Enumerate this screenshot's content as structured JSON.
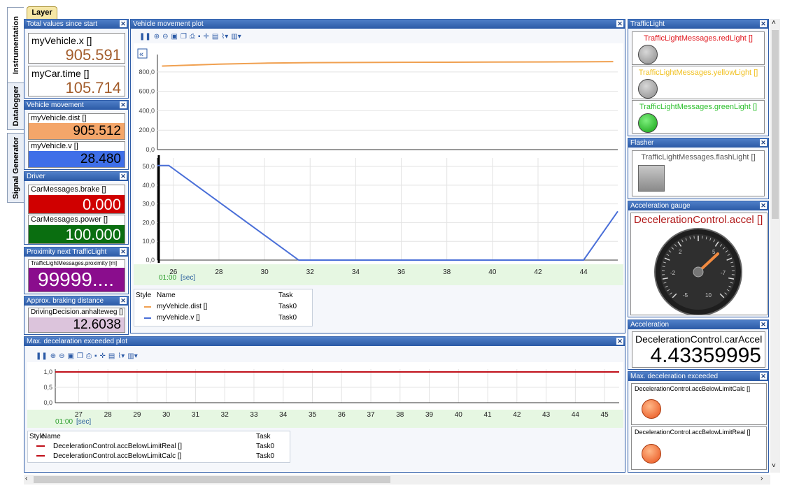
{
  "tabs": {
    "layer": "Layer",
    "vertical": [
      "Instrumentation",
      "Datalogger",
      "Signal Generator"
    ]
  },
  "panels": {
    "total": {
      "title": "Total values since start",
      "items": [
        {
          "label": "myVehicle.x []",
          "value": "905.591"
        },
        {
          "label": "myCar.time []",
          "value": "105.714"
        }
      ]
    },
    "movement": {
      "title": "Vehicle movement",
      "items": [
        {
          "label": "myVehicle.dist []",
          "value": "905.512"
        },
        {
          "label": "myVehicle.v []",
          "value": "28.480"
        }
      ]
    },
    "driver": {
      "title": "Driver",
      "items": [
        {
          "label": "CarMessages.brake []",
          "value": "0.000"
        },
        {
          "label": "CarMessages.power []",
          "value": "100.000"
        }
      ]
    },
    "proximity": {
      "title": "Proximity next TrafficLight",
      "label": "TrafficLightMessages.proximity [m]",
      "value": "99999...."
    },
    "braking": {
      "title": "Approx. braking distance",
      "label": "DrivingDecision.anhalteweg []",
      "value": "12.6038"
    },
    "plot": {
      "title": "Vehicle movement plot"
    },
    "maxplot": {
      "title": "Max. decelaration exceeded plot"
    },
    "traffic": {
      "title": "TrafficLight",
      "red": "TrafficLightMessages.redLight []",
      "yellow": "TrafficLightMessages.yellowLight []",
      "green": "TrafficLightMessages.greenLight []"
    },
    "flasher": {
      "title": "Flasher",
      "label": "TrafficLightMessages.flashLight []"
    },
    "gauge": {
      "title": "Acceleration gauge",
      "label": "DecelerationControl.accel []",
      "ticks": [
        "-5",
        "-2",
        "10",
        "-7",
        "2",
        "5"
      ]
    },
    "accel": {
      "title": "Acceleration",
      "label": "DecelerationControl.carAccel []",
      "value": "4.43359995"
    },
    "maxdec": {
      "title": "Max. deceleration exceeded",
      "items": [
        "DecelerationControl.accBelowLimitCalc []",
        "DecelerationControl.accBelowLimitReal []"
      ]
    }
  },
  "legend_headers": {
    "style": "Style",
    "name": "Name",
    "task": "Task"
  },
  "plot_legend": [
    {
      "name": "myVehicle.dist []",
      "task": "Task0",
      "color": "#f0a050"
    },
    {
      "name": "myVehicle.v []",
      "task": "Task0",
      "color": "#4a6fd8"
    }
  ],
  "maxplot_legend": [
    {
      "name": "DecelerationControl.accBelowLimitReal []",
      "task": "Task0",
      "color": "#c0101a"
    },
    {
      "name": "DecelerationControl.accBelowLimitCalc []",
      "task": "Task0",
      "color": "#c0101a"
    }
  ],
  "time_prefix": "01:00",
  "time_unit": "[sec]",
  "chart_data": [
    {
      "type": "line",
      "series": [
        {
          "name": "myVehicle.dist []",
          "x": [
            25.5,
            28,
            30,
            32,
            34,
            36,
            38,
            40,
            42,
            44,
            45.3
          ],
          "values": [
            860,
            880,
            890,
            895,
            897,
            899,
            900,
            901,
            902,
            904,
            906
          ]
        }
      ],
      "yticks": [
        "800,0",
        "600,0",
        "400,0",
        "200,0",
        "0,0"
      ],
      "ylim": [
        0,
        950
      ],
      "xlim": [
        25.3,
        45.5
      ]
    },
    {
      "type": "line",
      "series": [
        {
          "name": "myVehicle.v []",
          "x": [
            25.3,
            25.8,
            31.5,
            44,
            45.5
          ],
          "values": [
            50.5,
            50.5,
            0,
            0,
            26
          ]
        }
      ],
      "yticks": [
        "50,0",
        "40,0",
        "30,0",
        "20,0",
        "10,0",
        "0,0"
      ],
      "ylim": [
        0,
        53
      ],
      "xlim": [
        25.3,
        45.5
      ],
      "xticks": [
        "26",
        "28",
        "30",
        "32",
        "34",
        "36",
        "38",
        "40",
        "42",
        "44"
      ]
    },
    {
      "type": "line",
      "series": [
        {
          "name": "DecelerationControl.accBelowLimitReal []",
          "x": [
            26.2,
            45.5
          ],
          "values": [
            1,
            1
          ]
        }
      ],
      "yticks": [
        "1,0",
        "0,5",
        "0,0"
      ],
      "ylim": [
        0,
        1
      ],
      "xlim": [
        26.2,
        45.5
      ],
      "xticks": [
        "27",
        "28",
        "29",
        "30",
        "31",
        "32",
        "33",
        "34",
        "35",
        "36",
        "37",
        "38",
        "39",
        "40",
        "41",
        "42",
        "43",
        "44",
        "45"
      ]
    }
  ]
}
